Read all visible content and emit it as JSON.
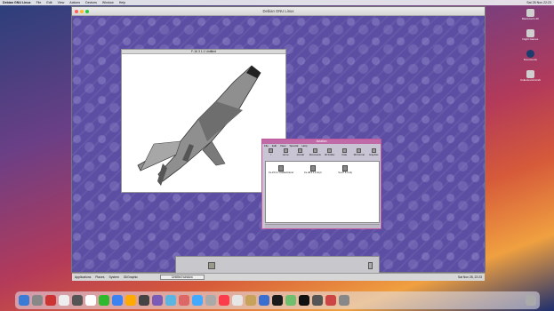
{
  "menubar": {
    "app": "Debian GNU Linux",
    "items": [
      "File",
      "Edit",
      "View",
      "Actions",
      "Devices",
      "Window",
      "Help"
    ],
    "clock": "Sat 28 Nov 22:23"
  },
  "vm": {
    "title": "Debian GNU Linux"
  },
  "plane_window": {
    "title": "F-16 3 1.1 Untitled"
  },
  "avi_window": {
    "title": "Aviation",
    "menu": [
      "File",
      "Edit",
      "View",
      "Special",
      "Help"
    ],
    "toolbar": [
      "/",
      "Home",
      "Aircraft",
      "Documents",
      "3D Folder",
      "Data",
      "3D Format",
      "Graphics"
    ],
    "files": [
      {
        "name": "Fu-15.3.1 Untitled.blend"
      },
      {
        "name": "Fu-48.3.1.2.obj b"
      },
      {
        "name": "Su-27 6.3.obj"
      }
    ]
  },
  "taskbar": {
    "items": [
      "Applications",
      "Places",
      "System"
    ],
    "app": "3DGraphic",
    "task": "Untitled window",
    "clock": "Sat Nov 28, 22:23"
  },
  "side_icons": [
    {
      "label": "Macintosh HD"
    },
    {
      "label": "Flight Games"
    },
    {
      "label": "Documents"
    },
    {
      "label": "Collected Aircraft"
    }
  ],
  "colors": {
    "desktop": "#5b4ea3",
    "avi_title": "#c06aa8"
  }
}
